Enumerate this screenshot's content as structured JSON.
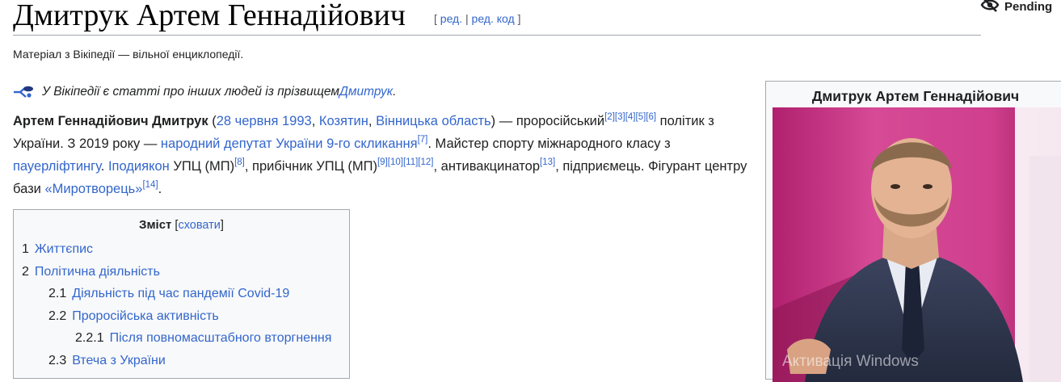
{
  "page": {
    "title": "Дмитрук Артем Геннадійович",
    "edit_open": "[ ",
    "edit_label": "ред.",
    "edit_sep": " | ",
    "edit_code_label": "ред. код",
    "edit_close": " ]",
    "pending_label": "Pending",
    "tagline": "Матеріал з Вікіпедії — вільної енциклопедії."
  },
  "hatnote": {
    "text_before": "У Вікіпедії є статті про інших людей із прізвищем ",
    "link": "Дмитрук",
    "text_after": "."
  },
  "lead": {
    "name_bold": "Артем Геннадійович Дмитрук",
    "p1": " (",
    "date_link": "28 червня 1993",
    "comma": ", ",
    "place1_link": "Козятин",
    "comma2": ", ",
    "place2_link": "Вінницька область",
    "p2": ") — проросійський",
    "refs_a": [
      "[2]",
      "[3]",
      "[4]",
      "[5]",
      "[6]"
    ],
    "p3": " політик з України. З 2019 року — ",
    "deputy_link": "народний депутат України 9-го скликання",
    "ref7": "[7]",
    "p4": ". Майстер спорту міжнародного класу з ",
    "powerlifting_link": "пауерліфтингу",
    "p5": ". ",
    "hypodeacon_link": "Іподиякон",
    "p6": " УПЦ (МП)",
    "ref8": "[8]",
    "p7": ", прибічник УПЦ (МП)",
    "refs_b": [
      "[9]",
      "[10]",
      "[11]",
      "[12]"
    ],
    "p8": ", антивакцинатор",
    "ref13": "[13]",
    "p9": ", підприємець. Фігурант центру бази ",
    "myrotvorets_link": "«Миротворець»",
    "ref14": "[14]",
    "p10": "."
  },
  "toc": {
    "title": "Зміст",
    "toggle_open": " [",
    "toggle_label": "сховати",
    "toggle_close": "]",
    "items": [
      {
        "num": "1",
        "label": "Життєпис"
      },
      {
        "num": "2",
        "label": "Політична діяльність"
      },
      {
        "num": "2.1",
        "label": "Діяльність під час пандемії Covid-19"
      },
      {
        "num": "2.2",
        "label": "Проросійська активність"
      },
      {
        "num": "2.2.1",
        "label": "Після повномасштабного вторгнення"
      },
      {
        "num": "2.3",
        "label": "Втеча з України"
      }
    ]
  },
  "infobox": {
    "title": "Дмитрук Артем Геннадійович"
  },
  "watermark": "Активація Windows",
  "colors": {
    "link": "#3366cc",
    "text": "#202122",
    "border": "#a2a9b1",
    "box_bg": "#f8f9fa"
  }
}
